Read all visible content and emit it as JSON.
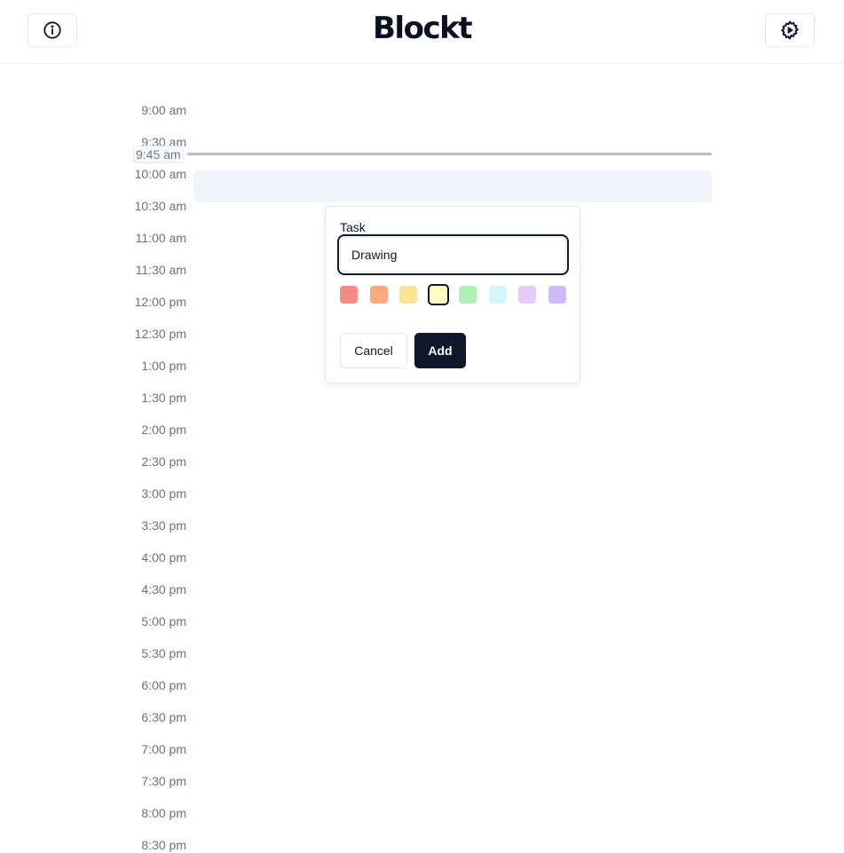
{
  "header": {
    "brand": "Blockt",
    "info_icon": "info-circle-icon",
    "settings_icon": "gear-play-icon"
  },
  "timeline": {
    "labels": [
      "9:00 am",
      "9:30 am",
      "10:00 am",
      "10:30 am",
      "11:00 am",
      "11:30 am",
      "12:00 pm",
      "12:30 pm",
      "1:00 pm",
      "1:30 pm",
      "2:00 pm",
      "2:30 pm",
      "3:00 pm",
      "3:30 pm",
      "4:00 pm",
      "4:30 pm",
      "5:00 pm",
      "5:30 pm",
      "6:00 pm",
      "6:30 pm",
      "7:00 pm",
      "7:30 pm",
      "8:00 pm",
      "8:30 pm"
    ],
    "current_time": "9:45 am"
  },
  "popover": {
    "task_label": "Task",
    "task_value": "Drawing",
    "colors": [
      "#f58a84",
      "#fbaa7e",
      "#fde594",
      "#fdfec4",
      "#aff2b6",
      "#d5f5fd",
      "#e4ccfa",
      "#d0b9fc"
    ],
    "selected_color_index": 3,
    "cancel_label": "Cancel",
    "add_label": "Add"
  }
}
